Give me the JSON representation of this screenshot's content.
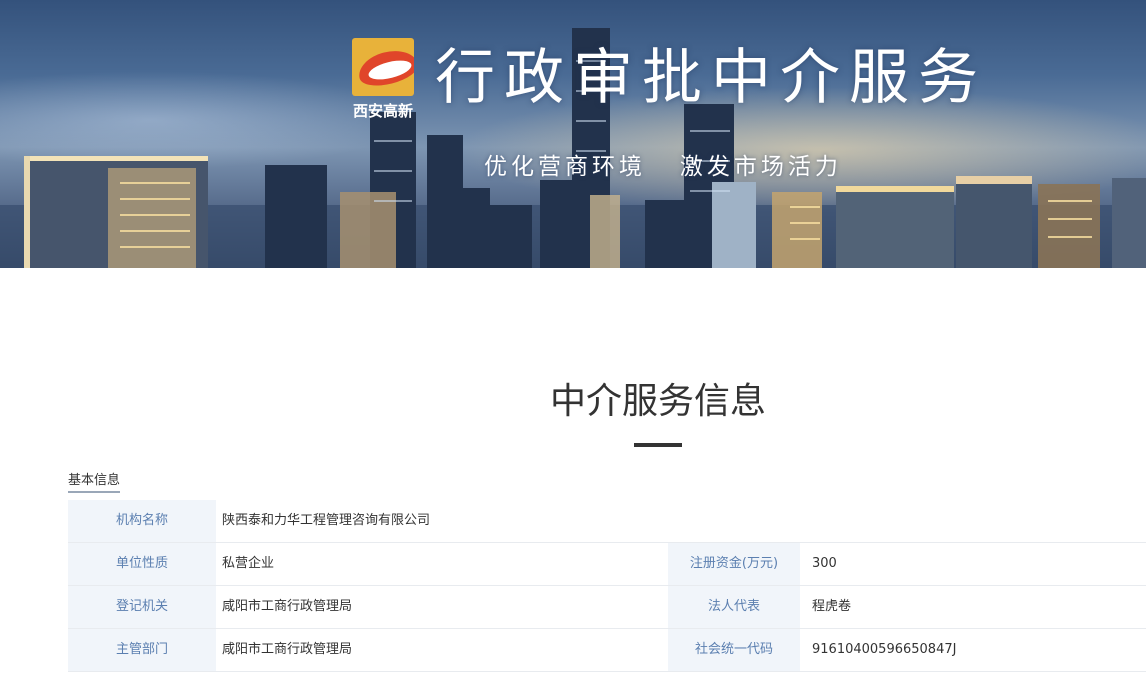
{
  "banner": {
    "logo_text": "西安高新",
    "title": "行政审批中介服务",
    "slogan": "优化营商环境   激发市场活力"
  },
  "main": {
    "title": "中介服务信息",
    "section_label": "基本信息",
    "rows": [
      {
        "label1": "机构名称",
        "value1": "陕西泰和力华工程管理咨询有限公司"
      },
      {
        "label1": "单位性质",
        "value1": "私营企业",
        "label2": "注册资金(万元)",
        "value2": "300"
      },
      {
        "label1": "登记机关",
        "value1": "咸阳市工商行政管理局",
        "label2": "法人代表",
        "value2": "程虎卷"
      },
      {
        "label1": "主管部门",
        "value1": "咸阳市工商行政管理局",
        "label2": "社会统一代码",
        "value2": "91610400596650847J"
      }
    ]
  },
  "colors": {
    "label_text": "#5b7fb0",
    "label_bg": "#f1f5fa",
    "logo_orange": "#e8b23a",
    "logo_red": "#e0452a"
  }
}
